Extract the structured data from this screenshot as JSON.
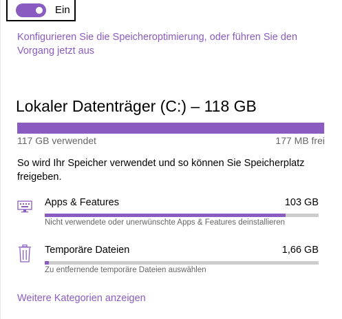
{
  "storage_sense": {
    "toggle_state": "Ein",
    "toggle_on": true,
    "configure_link": "Konfigurieren Sie die Speicheroptimierung, oder führen Sie den Vorgang jetzt aus"
  },
  "drive": {
    "title": "Lokaler Datenträger (C:) – 118 GB",
    "used_label": "117 GB verwendet",
    "free_label": "177 MB frei",
    "used_fraction": 0.9985
  },
  "usage_description": "So wird Ihr Speicher verwendet und so können Sie Speicherplatz freigeben.",
  "categories": [
    {
      "name": "Apps & Features",
      "size": "103 GB",
      "description": "Nicht verwendete oder unerwünschte Apps & Features deinstallieren",
      "icon": "keyboard-icon",
      "fraction": 0.88
    },
    {
      "name": "Temporäre Dateien",
      "size": "1,66 GB",
      "description": "Zu entfernende temporäre Dateien auswählen",
      "icon": "trash-icon",
      "fraction": 0.015
    }
  ],
  "more_categories_link": "Weitere Kategorien anzeigen",
  "colors": {
    "accent": "#8a5cc2",
    "bar_track": "#e6e6e6",
    "sub_text": "#666666"
  }
}
